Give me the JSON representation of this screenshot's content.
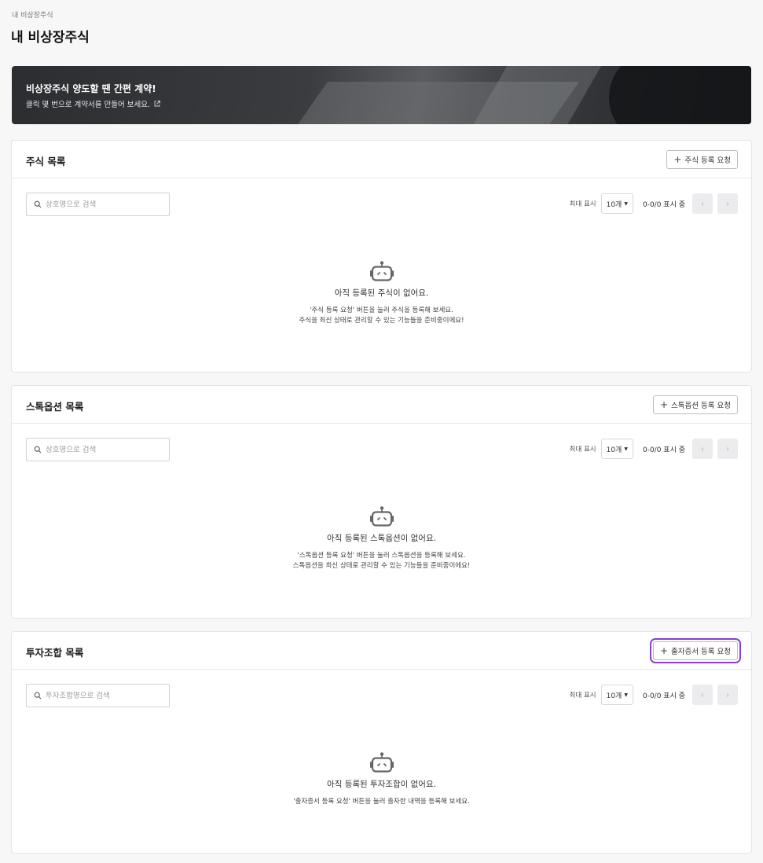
{
  "breadcrumb": "내 비상장주식",
  "page_title": "내 비상장주식",
  "banner": {
    "title": "비상장주식 양도할 땐 간편 계약!",
    "subtitle": "클릭 몇 번으로 계약서를 만들어 보세요."
  },
  "sections": [
    {
      "title": "주식 목록",
      "request_button": "주식 등록 요청",
      "search_placeholder": "상호명으로 검색",
      "per_page_label": "최대 표시",
      "per_page_value": "10개",
      "range_text": "0-0/0 표시 중",
      "empty_title": "아직 등록된 주식이 없어요.",
      "empty_desc_1": "'주식 등록 요청' 버튼을 눌러 주식을 등록해 보세요.",
      "empty_desc_2": "주식을 최신 상태로 관리할 수 있는 기능들을 준비중이에요!"
    },
    {
      "title": "스톡옵션 목록",
      "request_button": "스톡옵션 등록 요청",
      "search_placeholder": "상호명으로 검색",
      "per_page_label": "최대 표시",
      "per_page_value": "10개",
      "range_text": "0-0/0 표시 중",
      "empty_title": "아직 등록된 스톡옵션이 없어요.",
      "empty_desc_1": "'스톡옵션 등록 요청' 버튼을 눌러 스톡옵션을 등록해 보세요.",
      "empty_desc_2": "스톡옵션을 최신 상태로 관리할 수 있는 기능들을 준비중이에요!"
    },
    {
      "title": "투자조합 목록",
      "request_button": "출자증서 등록 요청",
      "search_placeholder": "투자조합명으로 검색",
      "per_page_label": "최대 표시",
      "per_page_value": "10개",
      "range_text": "0-0/0 표시 중",
      "empty_title": "아직 등록된 투자조합이 없어요.",
      "empty_desc_1": "'출자증서 등록 요청' 버튼을 눌러 출자한 내역을 등록해 보세요."
    }
  ],
  "pager_icons": {
    "prev": "‹",
    "next": "›"
  },
  "colors": {
    "highlight": "#8a3fd1",
    "banner_bg": "#2b2d31"
  }
}
